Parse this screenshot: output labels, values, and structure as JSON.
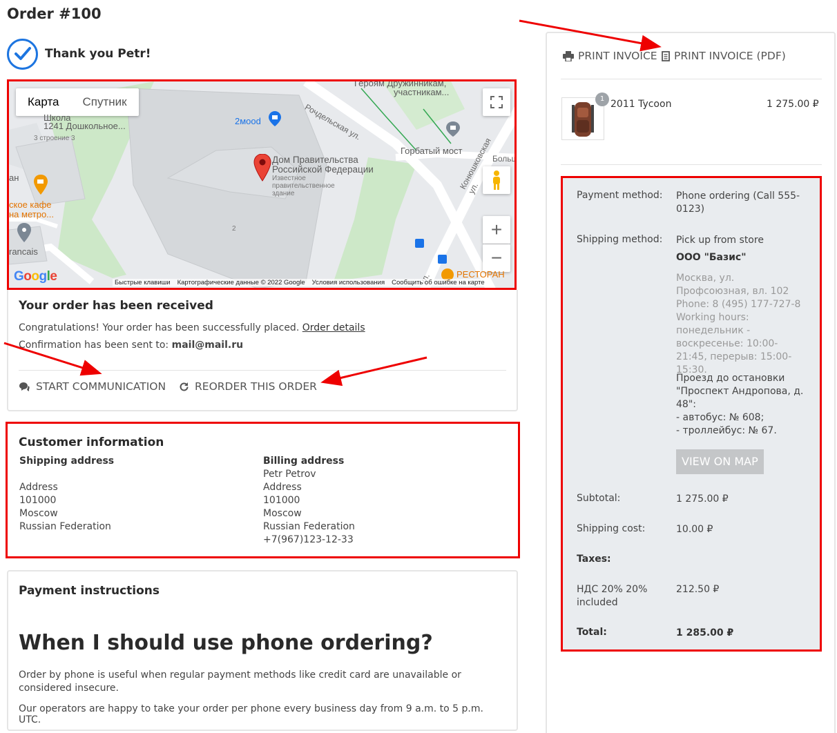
{
  "page": {
    "title": "Order #100",
    "thanks": "Thank you Petr!"
  },
  "map": {
    "tabs": [
      "Карта",
      "Спутник"
    ],
    "pin_title": "Дом Правительства Российской Федерации",
    "pin_sub": "Известное правительственное здание",
    "labels": {
      "school": "1241 Дошкольное...",
      "school_top": "Школа",
      "school_building": "3 строение 3",
      "cafe": "ское кафе",
      "metro": "на метро...",
      "francais": "rancais",
      "mood": "2мood",
      "heroes": "Героям Дружинникам,",
      "heroes2": "участникам...",
      "humpback": "Горбатый мост",
      "rochdel": "Рочдельская ул.",
      "konyush": "Конюшковская ул.",
      "bolsh": "Больш",
      "restaurant": "РЕСТОРАН",
      "num2": "2",
      "rus_ul": "ул.",
      "an": "ан"
    },
    "footer": [
      "Быстрые клавиши",
      "Картографические данные © 2022 Google",
      "Условия использования",
      "Сообщить об ошибке на карте"
    ],
    "zoom_in": "+",
    "zoom_out": "−",
    "google": "Google"
  },
  "received": {
    "heading": "Your order has been received",
    "congrats": "Congratulations! Your order has been successfully placed.",
    "order_details_link": "Order details",
    "confirmation_prefix": "Confirmation has been sent to:",
    "email": "mail@mail.ru",
    "actions": {
      "start_communication": "START COMMUNICATION",
      "reorder": "REORDER THIS ORDER"
    }
  },
  "customer": {
    "heading": "Customer information",
    "shipping": {
      "label": "Shipping address",
      "lines": [
        "",
        "Address",
        "101000",
        "Moscow",
        "Russian Federation"
      ]
    },
    "billing": {
      "label": "Billing address",
      "lines": [
        "Petr Petrov",
        "Address",
        "101000",
        "Moscow",
        "Russian Federation",
        "+7(967)123-12-33"
      ]
    }
  },
  "payment_instructions": {
    "heading": "Payment instructions",
    "title": "When I should use phone ordering?",
    "para1": "Order by phone is useful when regular payment methods like credit card are unavailable or considered insecure.",
    "para2": "Our operators are happy to take your order per phone every business day from 9 a.m. to 5 p.m. UTC."
  },
  "sidebar": {
    "print_invoice": "PRINT INVOICE",
    "print_invoice_pdf": "PRINT INVOICE (PDF)",
    "product": {
      "name": "2011 Tycoon",
      "price": "1 275.00 ₽",
      "qty": "1"
    },
    "payment_method_label": "Payment method:",
    "payment_method_value": "Phone ordering (Call 555-0123)",
    "shipping_method_label": "Shipping method:",
    "shipping_method_value": "Pick up from store",
    "store_name": "ООО \"Базис\"",
    "store_address": "Москва, ул. Профсоюзная, вл. 102",
    "store_phone": "Phone: 8 (495) 177-727-8",
    "store_hours": "Working hours: понедельник - воскресенье: 10:00-21:45, перерыв: 15:00-15:30.",
    "store_directions": "Проезд до остановки \"Проспект Андропова, д. 48\":",
    "store_bus": "- автобус: № 608;",
    "store_trolley": "- троллейбус: № 67.",
    "view_on_map": "VIEW ON MAP",
    "subtotal_label": "Subtotal:",
    "subtotal_value": "1 275.00 ₽",
    "shipping_cost_label": "Shipping cost:",
    "shipping_cost_value": "10.00 ₽",
    "taxes_label": "Taxes:",
    "vat_label": "НДС 20% 20% included",
    "vat_value": "212.50 ₽",
    "total_label": "Total:",
    "total_value": "1 285.00 ₽"
  },
  "colors": {
    "accent": "#1d75e0",
    "annotation": "#ee0000",
    "summary_bg": "#e9ecef"
  }
}
